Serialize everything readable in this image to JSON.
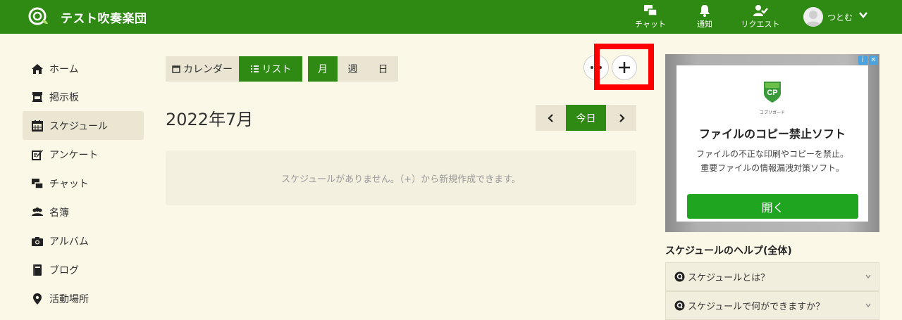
{
  "header": {
    "app_title": "テスト吹奏楽団",
    "nav": [
      {
        "label": "チャット",
        "icon": "chat-icon"
      },
      {
        "label": "通知",
        "icon": "bell-icon"
      },
      {
        "label": "リクエスト",
        "icon": "request-icon"
      }
    ],
    "user_name": "つとむ"
  },
  "sidebar": {
    "items": [
      {
        "label": "ホーム",
        "icon": "home-icon"
      },
      {
        "label": "掲示板",
        "icon": "board-icon"
      },
      {
        "label": "スケジュール",
        "icon": "calendar-icon",
        "active": true
      },
      {
        "label": "アンケート",
        "icon": "survey-icon"
      },
      {
        "label": "チャット",
        "icon": "chat-icon"
      },
      {
        "label": "名簿",
        "icon": "members-icon"
      },
      {
        "label": "アルバム",
        "icon": "camera-icon"
      },
      {
        "label": "ブログ",
        "icon": "book-icon"
      },
      {
        "label": "活動場所",
        "icon": "map-pin-icon"
      }
    ]
  },
  "view_toggle": {
    "calendar": "カレンダー",
    "list": "リスト",
    "active": "list"
  },
  "range_toggle": {
    "month": "月",
    "week": "週",
    "day": "日",
    "active": "month"
  },
  "main": {
    "month_title": "2022年7月",
    "today_label": "今日",
    "empty_message": "スケジュールがありません。（+）から新規作成できます。"
  },
  "ad": {
    "brand": "コプリガード",
    "title": "ファイルのコピー禁止ソフト",
    "desc_line1": "ファイルの不正な印刷やコピーを禁止。",
    "desc_line2": "重要ファイルの情報漏洩対策ソフト。",
    "button": "開く"
  },
  "help": {
    "title": "スケジュールのヘルプ(全体)",
    "faq": [
      "スケジュールとは？",
      "スケジュールで何ができますか？"
    ]
  },
  "colors": {
    "brand": "#2f8a13",
    "background": "#fbf8e7",
    "highlight": "#ff0000"
  }
}
